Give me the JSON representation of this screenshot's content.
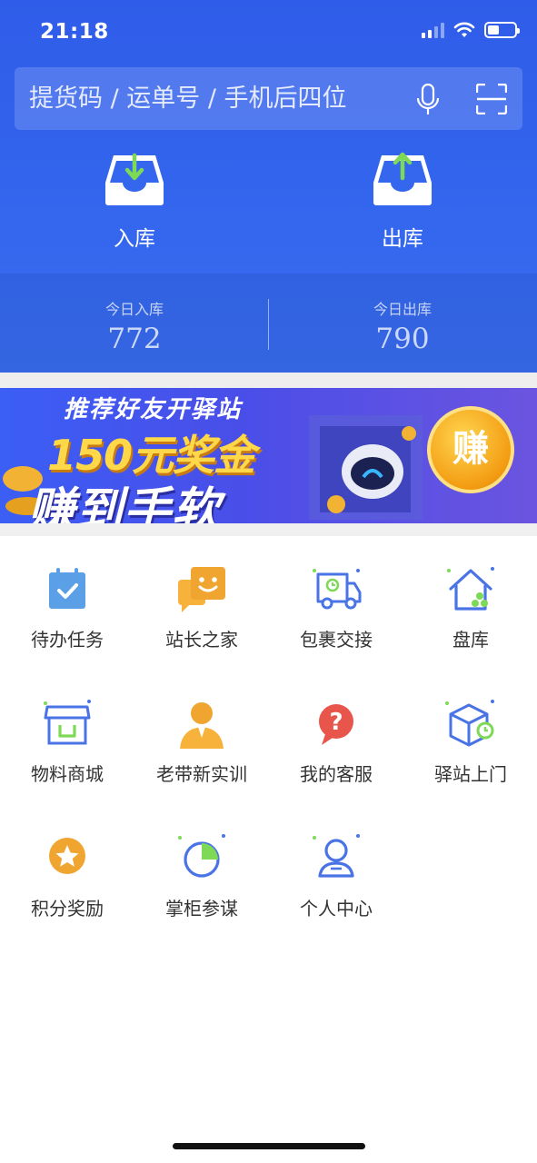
{
  "status_bar": {
    "time": "21:18"
  },
  "search": {
    "placeholder": "提货码 / 运单号 / 手机后四位"
  },
  "actions": [
    {
      "label": "入库"
    },
    {
      "label": "出库"
    }
  ],
  "stats": [
    {
      "title": "今日入库",
      "value": "772"
    },
    {
      "title": "今日出库",
      "value": "790"
    }
  ],
  "banner": {
    "line1": "推荐好友开驿站",
    "line2": "150元奖金",
    "line3": "赚到手软",
    "badge": "赚"
  },
  "grid": [
    {
      "label": "待办任务",
      "icon": "calendar-check-icon"
    },
    {
      "label": "站长之家",
      "icon": "chat-smile-icon"
    },
    {
      "label": "包裹交接",
      "icon": "delivery-truck-icon"
    },
    {
      "label": "盘库",
      "icon": "house-dots-icon"
    },
    {
      "label": "物料商城",
      "icon": "shop-icon"
    },
    {
      "label": "老带新实训",
      "icon": "mentor-icon"
    },
    {
      "label": "我的客服",
      "icon": "question-icon"
    },
    {
      "label": "驿站上门",
      "icon": "box-clock-icon"
    },
    {
      "label": "积分奖励",
      "icon": "star-medal-icon"
    },
    {
      "label": "掌柜参谋",
      "icon": "pie-chart-icon"
    },
    {
      "label": "个人中心",
      "icon": "user-icon"
    }
  ],
  "colors": {
    "header_blue": "#3466ee",
    "icon_blue": "#4a74e6",
    "icon_orange": "#f0a530",
    "icon_red": "#e8554a",
    "icon_green": "#7ed957"
  }
}
